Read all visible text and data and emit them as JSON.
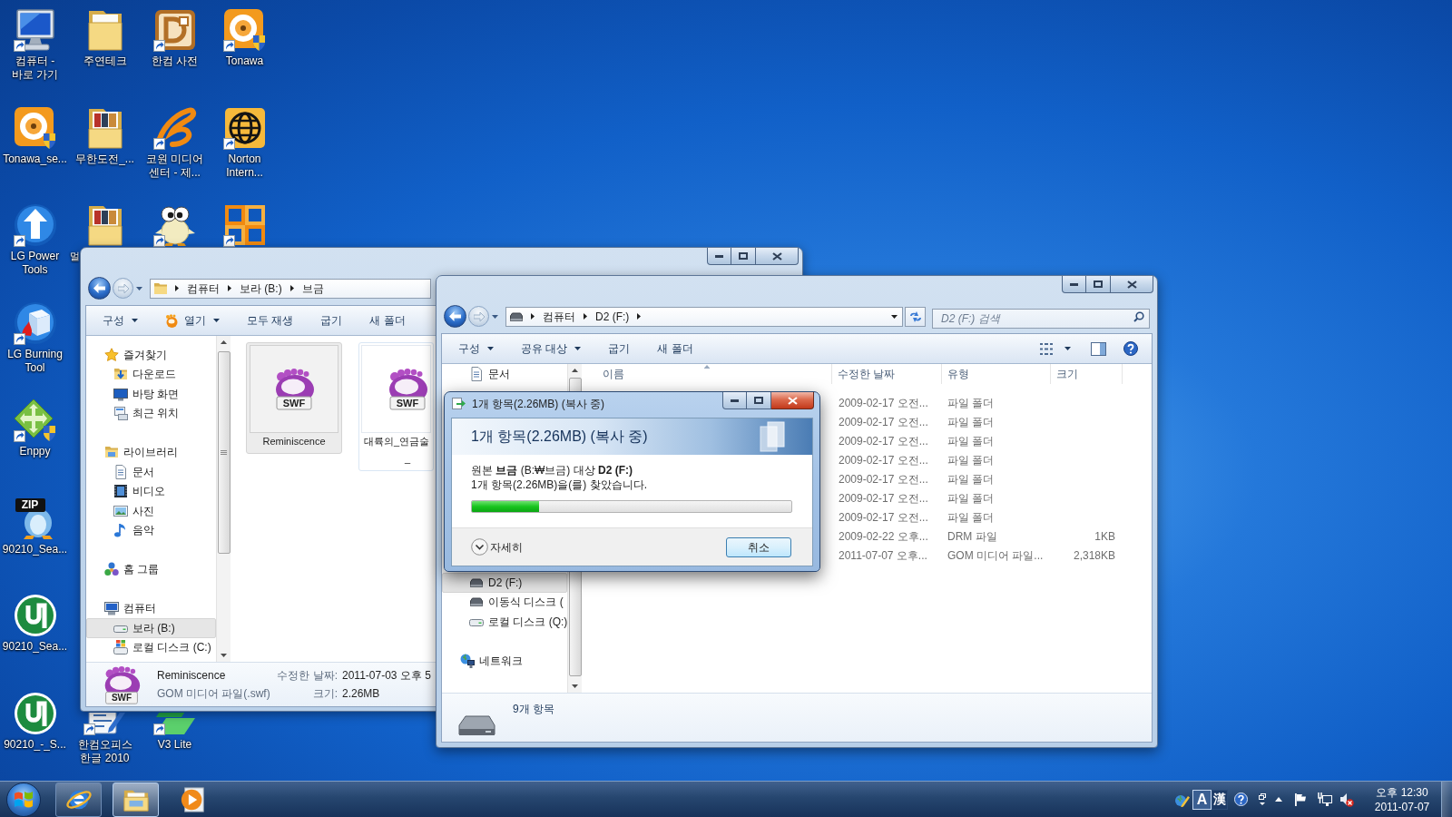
{
  "desktop": {
    "columns": [
      {
        "icons": [
          {
            "kind": "computer",
            "lines": [
              "컴퓨터 -",
              "바로 가기"
            ],
            "shortcut": true
          },
          {
            "kind": "ring_tile",
            "lines": [
              "Tonawa_se..."
            ],
            "shortcut": false
          },
          {
            "kind": "up_arrow",
            "lines": [
              "LG Power",
              "Tools"
            ],
            "shortcut": true
          },
          {
            "kind": "cube_disc",
            "lines": [
              "LG Burning",
              "Tool"
            ],
            "shortcut": true
          },
          {
            "kind": "move_arrows",
            "lines": [
              "Enppy"
            ],
            "shortcut": true
          },
          {
            "kind": "zip",
            "badge": "ZIP",
            "lines": [
              "90210_Sea..."
            ],
            "shortcut": false
          },
          {
            "kind": "circle_logo",
            "lines": [
              "90210_Sea..."
            ],
            "shortcut": false
          },
          {
            "kind": "circle_logo",
            "lines": [
              "90210_-_S..."
            ],
            "shortcut": false
          }
        ]
      },
      {
        "icons": [
          {
            "kind": "folder",
            "lines": [
              "주연테크"
            ],
            "shortcut": false
          },
          {
            "kind": "photo_folder",
            "lines": [
              "무한도전_..."
            ],
            "shortcut": false
          },
          {
            "kind": "photo_folder",
            "lines": [
              "멀"
            ],
            "shortcut": false,
            "label_cut": true
          }
        ],
        "bottom_icons": [
          {
            "kind": "document_pen",
            "lines": [
              "한컴오피스",
              "한글 2010"
            ],
            "shortcut": true,
            "art_cut": true
          }
        ]
      },
      {
        "icons": [
          {
            "kind": "letter_tile",
            "lines": [
              "한컴 사전"
            ],
            "shortcut": true
          },
          {
            "kind": "swoosh",
            "lines": [
              "코원 미디어",
              "센터 - 제..."
            ],
            "shortcut": true
          },
          {
            "kind": "character",
            "shortcut": true
          }
        ],
        "bottom_icons": [
          {
            "kind": "v_logo",
            "lines": [
              "V3 Lite"
            ],
            "shortcut": true,
            "art_cut": true
          }
        ]
      },
      {
        "icons": [
          {
            "kind": "ring_tile",
            "lines": [
              "Tonawa"
            ],
            "shortcut": true
          },
          {
            "kind": "globe_tile",
            "lines": [
              "Norton",
              "Intern..."
            ],
            "shortcut": true
          },
          {
            "kind": "squares_logo",
            "shortcut": true
          }
        ]
      }
    ]
  },
  "back_window": {
    "active": false,
    "breadcrumb_lead": {
      "kind": "folder"
    },
    "breadcrumb": [
      "컴퓨터",
      "보라 (B:)",
      "브금"
    ],
    "breadcrumb_more": false,
    "toolbar": [
      {
        "label": "구성",
        "kind": "menu"
      },
      {
        "label": "열기",
        "kind": "open_menu"
      },
      {
        "label": "모두 재생",
        "kind": "plain"
      },
      {
        "label": "굽기",
        "kind": "plain"
      },
      {
        "label": "새 폴더",
        "kind": "plain"
      }
    ],
    "nav": [
      {
        "label": "즐겨찾기",
        "kind": "star",
        "selected": false,
        "children": [
          {
            "label": "다운로드",
            "kind": "downloads",
            "selected": false
          },
          {
            "label": "바탕 화면",
            "kind": "desktop",
            "selected": false
          },
          {
            "label": "최근 위치",
            "kind": "recent",
            "selected": false
          }
        ]
      },
      {
        "label": "라이브러리",
        "kind": "library",
        "selected": false,
        "children": [
          {
            "label": "문서",
            "kind": "document",
            "selected": false
          },
          {
            "label": "비디오",
            "kind": "video",
            "selected": false
          },
          {
            "label": "사진",
            "kind": "picture",
            "selected": false
          },
          {
            "label": "음악",
            "kind": "music",
            "selected": false
          }
        ]
      },
      {
        "label": "홈 그룹",
        "kind": "homegroup",
        "selected": false
      },
      {
        "label": "컴퓨터",
        "kind": "computer",
        "selected": false,
        "children": [
          {
            "label": "보라 (B:)",
            "kind": "drive",
            "selected": true
          },
          {
            "label": "로컬 디스크 (C:)",
            "kind": "system_drive",
            "selected": false
          }
        ]
      }
    ],
    "files": [
      {
        "badge": "SWF",
        "lines": [
          "Reminiscence"
        ],
        "selected": true
      },
      {
        "badge": "SWF",
        "lines": [
          "대륙의_연금술",
          "_"
        ],
        "selected": false,
        "covered": true
      }
    ],
    "details": {
      "badge": "SWF",
      "name": "Reminiscence",
      "type": "GOM 미디어 파일(.swf)",
      "fields": [
        {
          "label": "수정한 날짜:",
          "value": "2011-07-03 오후 5"
        },
        {
          "label": "크기:",
          "value": "2.26MB"
        }
      ]
    }
  },
  "front_window": {
    "active": false,
    "breadcrumb_lead": {
      "kind": "removable"
    },
    "breadcrumb": [
      "컴퓨터",
      "D2 (F:)"
    ],
    "breadcrumb_more": true,
    "search": {
      "placeholder": "D2 (F:) 검색"
    },
    "toolbar": [
      {
        "label": "구성",
        "kind": "menu"
      },
      {
        "label": "공유 대상",
        "kind": "menu"
      },
      {
        "label": "굽기",
        "kind": "plain"
      },
      {
        "label": "새 폴더",
        "kind": "plain"
      }
    ],
    "nav_top": [
      {
        "label": "문서",
        "kind": "document",
        "selected": false
      }
    ],
    "nav_drives": [
      {
        "label": "D2 (F:)",
        "kind": "removable",
        "selected": true
      },
      {
        "label": "이동식 디스크 (",
        "kind": "removable",
        "selected": false
      },
      {
        "label": "로컬 디스크 (Q:)",
        "kind": "drive",
        "selected": false
      }
    ],
    "nav_network": {
      "label": "네트워크",
      "kind": "network",
      "selected": false
    },
    "columns": [
      {
        "label": "이름",
        "sorted": true
      },
      {
        "label": "수정한 날짜",
        "sorted": false
      },
      {
        "label": "유형",
        "sorted": false
      },
      {
        "label": "크기",
        "sorted": false
      }
    ],
    "rows": [
      {
        "date": "2009-02-17 오전...",
        "type": "파일 폴더"
      },
      {
        "date": "2009-02-17 오전...",
        "type": "파일 폴더"
      },
      {
        "date": "2009-02-17 오전...",
        "type": "파일 폴더"
      },
      {
        "date": "2009-02-17 오전...",
        "type": "파일 폴더"
      },
      {
        "date": "2009-02-17 오전...",
        "type": "파일 폴더"
      },
      {
        "date": "2009-02-17 오전...",
        "type": "파일 폴더"
      },
      {
        "date": "2009-02-17 오전...",
        "type": "파일 폴더"
      },
      {
        "date": "2009-02-22 오후...",
        "type": "DRM 파일",
        "size": "1KB"
      },
      {
        "date": "2011-07-07 오후...",
        "type": "GOM 미디어 파일...",
        "size": "2,318KB"
      }
    ],
    "status": "9개 항목"
  },
  "copy_dialog": {
    "active": true,
    "title": "1개 항목(2.26MB) (복사 중)",
    "heading": "1개 항목(2.26MB) (복사 중)",
    "route": "원본 **브금** (B:₩브금) 대상 **D2 (F:)**",
    "found": "1개 항목(2.26MB)을(를) 찾았습니다.",
    "progress": {
      "level": 0.21
    },
    "more": "자세히",
    "details_expanded": false,
    "cancel": "취소"
  },
  "taskbar": {
    "apps": [
      {
        "kind": "browser",
        "running": true,
        "selected": false
      },
      {
        "kind": "explorer",
        "running": true,
        "selected": true
      },
      {
        "kind": "player",
        "running": false,
        "selected": false
      }
    ],
    "ime": [
      {
        "label": "A",
        "selected": true
      },
      {
        "label": "漢",
        "selected": false
      }
    ],
    "volume_muted": true,
    "time": "오후 12:30",
    "date": "2011-07-07"
  }
}
